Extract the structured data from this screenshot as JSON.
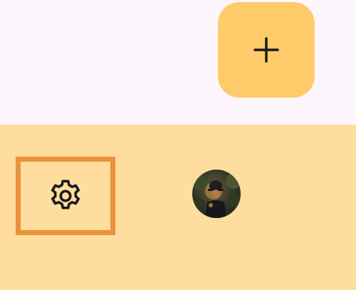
{
  "colors": {
    "top_background": "#FDF7FD",
    "bottom_bar_background": "#FFDD9E",
    "fab_background": "#FFCB6A",
    "selection_border": "#E8923C",
    "icon_color": "#1A1A1A"
  },
  "fab": {
    "icon": "plus-icon"
  },
  "bottom_bar": {
    "settings": {
      "icon": "gear-icon",
      "selected": true
    },
    "avatar": {
      "icon": "avatar-photo"
    }
  }
}
